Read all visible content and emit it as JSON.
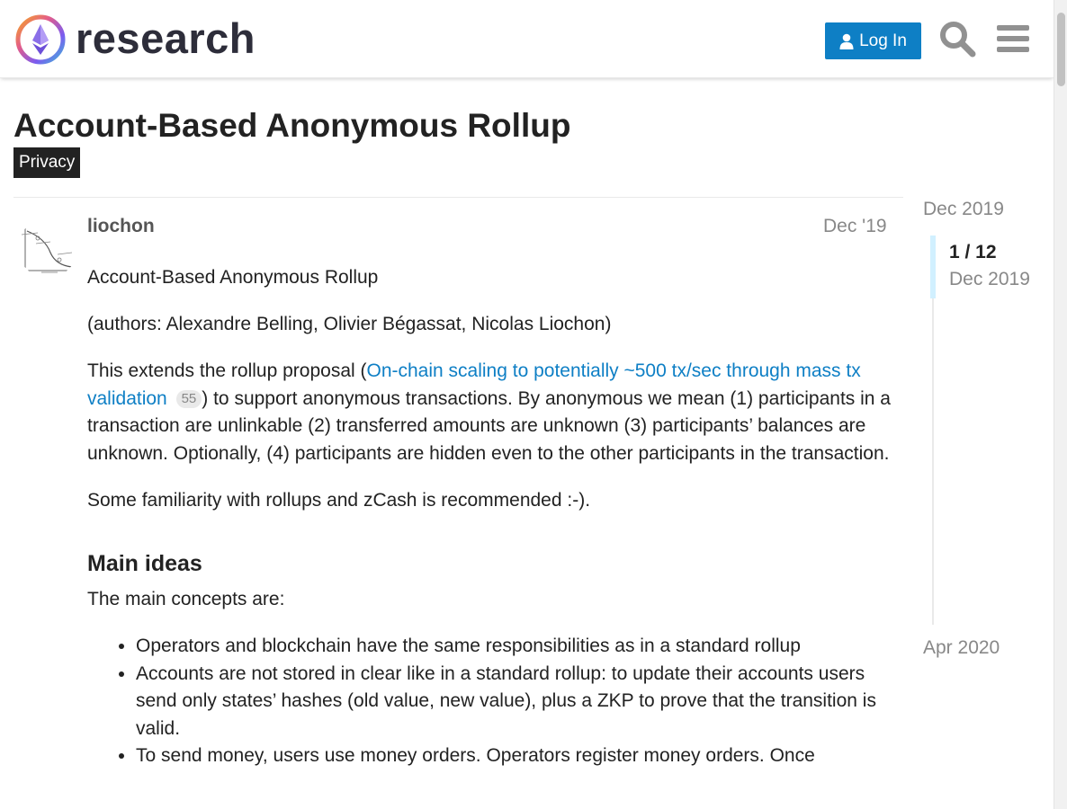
{
  "header": {
    "logo_text": "research",
    "login_label": "Log In",
    "icons": [
      "user-icon",
      "search-icon",
      "hamburger-menu-icon"
    ],
    "accent_color": "#0e7fc5"
  },
  "topic": {
    "title": "Account-Based Anonymous Rollup",
    "category": "Privacy"
  },
  "post": {
    "username": "liochon",
    "date": "Dec '19",
    "paragraphs": {
      "p1": "Account-Based Anonymous Rollup",
      "p2": "(authors: Alexandre Belling, Olivier Bégassat, Nicolas Liochon)",
      "p3_before": "This extends the rollup proposal (",
      "p3_link": "On-chain scaling to potentially ~500 tx/sec through mass tx validation",
      "p3_clicks": "55",
      "p3_after": ") to support anonymous transactions. By anonymous we mean (1) participants in a transaction are unlinkable (2) transferred amounts are unknown (3) participants’ balances are unknown. Optionally, (4) participants are hidden even to the other participants in the transaction.",
      "p4": "Some familiarity with rollups and zCash is recommended :-)."
    },
    "heading": "Main ideas",
    "intro": "The main concepts are:",
    "bullets": [
      "Operators and blockchain have the same responsibilities as in a standard rollup",
      "Accounts are not stored in clear like in a standard rollup: to update their accounts users send only states’ hashes (old value, new value), plus a ZKP to prove that the transition is valid.",
      "To send money, users use money orders. Operators register money orders. Once"
    ]
  },
  "timeline": {
    "start": "Dec 2019",
    "counter": "1 / 12",
    "current_date": "Dec 2019",
    "end": "Apr 2020"
  }
}
